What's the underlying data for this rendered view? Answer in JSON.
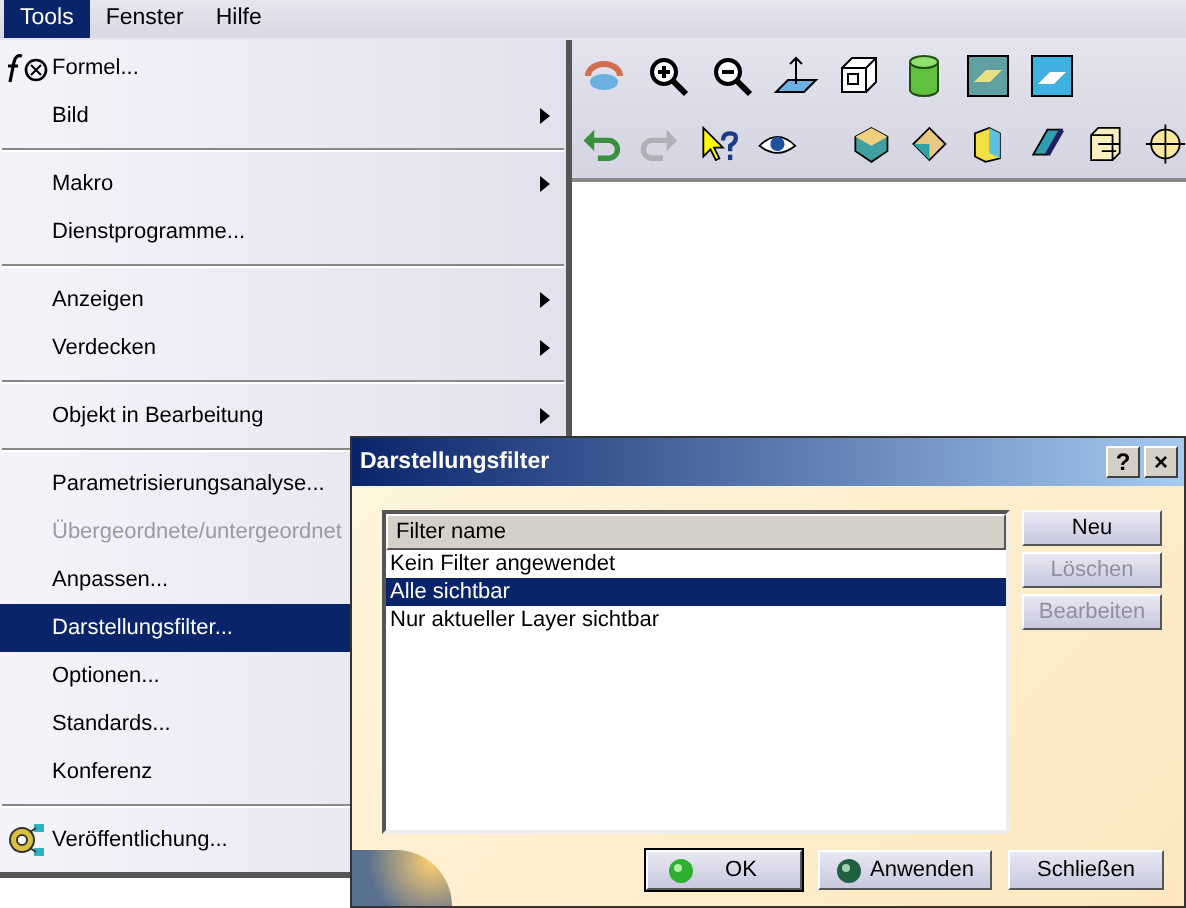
{
  "menubar": [
    {
      "label": "Tools",
      "selected": true
    },
    {
      "label": "Fenster",
      "selected": false
    },
    {
      "label": "Hilfe",
      "selected": false
    }
  ],
  "menu": {
    "groups": [
      [
        {
          "label": "Formel...",
          "kind": "formula",
          "submenu": false,
          "disabled": false,
          "selected": false
        },
        {
          "label": "Bild",
          "kind": "text",
          "submenu": true,
          "disabled": false,
          "selected": false
        }
      ],
      [
        {
          "label": "Makro",
          "kind": "text",
          "submenu": true,
          "disabled": false,
          "selected": false
        },
        {
          "label": "Dienstprogramme...",
          "kind": "text",
          "submenu": false,
          "disabled": false,
          "selected": false
        }
      ],
      [
        {
          "label": "Anzeigen",
          "kind": "text",
          "submenu": true,
          "disabled": false,
          "selected": false
        },
        {
          "label": "Verdecken",
          "kind": "text",
          "submenu": true,
          "disabled": false,
          "selected": false
        }
      ],
      [
        {
          "label": "Objekt in Bearbeitung",
          "kind": "text",
          "submenu": true,
          "disabled": false,
          "selected": false
        }
      ],
      [
        {
          "label": "Parametrisierungsanalyse...",
          "kind": "text",
          "disabled": false,
          "selected": false
        },
        {
          "label": "Übergeordnete/untergeordnet",
          "kind": "text",
          "disabled": true,
          "selected": false
        },
        {
          "label": "Anpassen...",
          "kind": "text",
          "disabled": false,
          "selected": false
        },
        {
          "label": "Darstellungsfilter...",
          "kind": "text",
          "disabled": false,
          "selected": true
        },
        {
          "label": "Optionen...",
          "kind": "text",
          "disabled": false,
          "selected": false
        },
        {
          "label": "Standards...",
          "kind": "text",
          "disabled": false,
          "selected": false
        },
        {
          "label": "Konferenz",
          "kind": "text",
          "disabled": false,
          "selected": false
        }
      ],
      [
        {
          "label": "Veröffentlichung...",
          "kind": "publish",
          "disabled": false,
          "selected": false
        }
      ]
    ]
  },
  "dialog": {
    "title": "Darstellungsfilter",
    "help": "?",
    "close": "×",
    "list": {
      "header": "Filter name",
      "rows": [
        {
          "label": "Kein Filter angewendet",
          "selected": false
        },
        {
          "label": "Alle sichtbar",
          "selected": true
        },
        {
          "label": "Nur aktueller Layer sichtbar",
          "selected": false
        }
      ]
    },
    "side_buttons": [
      {
        "label": "Neu",
        "disabled": false
      },
      {
        "label": "Löschen",
        "disabled": true
      },
      {
        "label": "Bearbeiten",
        "disabled": true
      }
    ],
    "bottom_buttons": [
      {
        "label": "OK",
        "kind": "ok",
        "focused": true
      },
      {
        "label": "Anwenden",
        "kind": "apply",
        "focused": false
      },
      {
        "label": "Schließen",
        "kind": "plain",
        "focused": false
      }
    ]
  }
}
